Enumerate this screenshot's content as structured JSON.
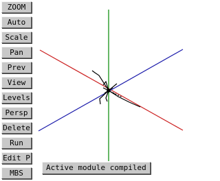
{
  "toolbar": {
    "buttons": [
      "ZOOM",
      "Auto",
      "Scale",
      "Pan",
      "Prev",
      "View",
      "Levels",
      "Persp",
      "Delete",
      "Run",
      "Edit P",
      "MBS"
    ]
  },
  "status": {
    "message": "Active module compiled !"
  },
  "viewport": {
    "axis_colors": {
      "x": "#cc2222",
      "y": "#008800",
      "z": "#1a1aaa"
    }
  }
}
